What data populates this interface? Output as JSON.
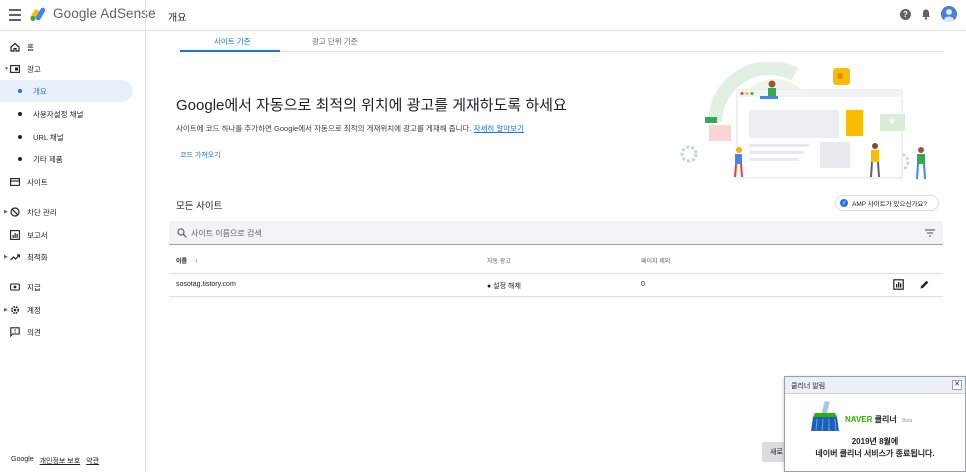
{
  "header": {
    "brand": "Google AdSense",
    "page_title": "개요",
    "help_icon": "help-circle-icon",
    "notification_icon": "bell-icon",
    "avatar_icon": "account-avatar-icon"
  },
  "sidebar": {
    "items": [
      {
        "label": "홈",
        "icon": "home-icon"
      },
      {
        "label": "광고",
        "icon": "ads-icon"
      },
      {
        "label": "개요"
      },
      {
        "label": "사용자설정 채널"
      },
      {
        "label": "URL 채널"
      },
      {
        "label": "기타 제품"
      },
      {
        "label": "사이트",
        "icon": "sites-icon"
      },
      {
        "label": "차단 관리",
        "icon": "block-icon"
      },
      {
        "label": "보고서",
        "icon": "reports-icon"
      },
      {
        "label": "최적화",
        "icon": "trending-icon"
      },
      {
        "label": "지급",
        "icon": "payments-icon"
      },
      {
        "label": "계정",
        "icon": "settings-icon"
      },
      {
        "label": "의견",
        "icon": "feedback-icon"
      }
    ],
    "footer": {
      "google": "Google",
      "privacy": "개인정보 보호",
      "terms": "약관"
    }
  },
  "tabs": [
    {
      "label": "사이트 기준",
      "active": true
    },
    {
      "label": "광고 단위 기준",
      "active": false
    }
  ],
  "hero": {
    "title": "Google에서 자동으로 최적의 위치에 광고를 게재하도록 하세요",
    "description": "사이트에 코드 하나를 추가하면 Google에서 자동으로 최적의 게재위치에 광고를 게재해 줍니다.",
    "learn_more": "자세히 알아보기",
    "get_code": "코드 가져오기"
  },
  "sites": {
    "title": "모든 사이트",
    "amp_button": "AMP 사이트가 있으신가요?",
    "search_placeholder": "사이트 이름으로 검색",
    "columns": {
      "name": "이름",
      "auto_ads": "자동 광고",
      "page_exclusions": "페이지 제외"
    },
    "rows": [
      {
        "name": "sosotag.tistory.com",
        "auto_ads": "설정 해제",
        "page_exclusions": "0"
      }
    ]
  },
  "cleaner_popup": {
    "title": "클리너 알림",
    "brand_naver": "NAVER",
    "brand_cleaner": "클리너",
    "brand_beta": "Beta",
    "message_line1": "2019년 8월에",
    "message_line2": "네이버 클리너 서비스가 종료됩니다."
  },
  "behind_button": "새로",
  "colors": {
    "accent": "#1a73e8",
    "naver_green": "#2db400",
    "active_nav_bg": "#e8f0fe"
  }
}
